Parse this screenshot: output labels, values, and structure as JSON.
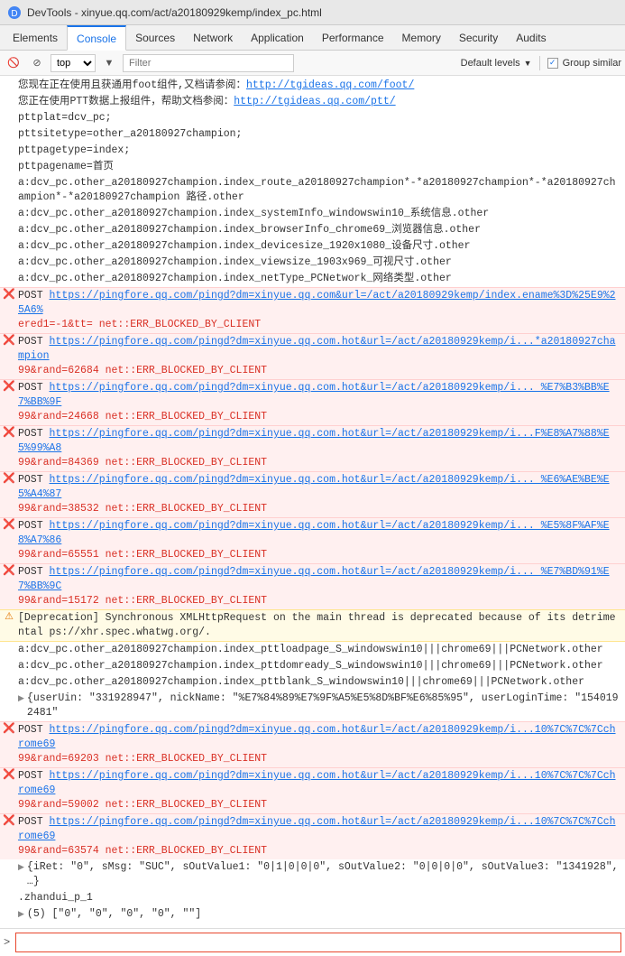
{
  "titleBar": {
    "icon": "devtools-icon",
    "title": "DevTools - xinyue.qq.com/act/a20180929kemp/index_pc.html"
  },
  "navTabs": [
    {
      "id": "elements",
      "label": "Elements",
      "active": false
    },
    {
      "id": "console",
      "label": "Console",
      "active": true
    },
    {
      "id": "sources",
      "label": "Sources",
      "active": false
    },
    {
      "id": "network",
      "label": "Network",
      "active": false
    },
    {
      "id": "application",
      "label": "Application",
      "active": false
    },
    {
      "id": "performance",
      "label": "Performance",
      "active": false
    },
    {
      "id": "memory",
      "label": "Memory",
      "active": false
    },
    {
      "id": "security",
      "label": "Security",
      "active": false
    },
    {
      "id": "audits",
      "label": "Audits",
      "active": false
    }
  ],
  "toolbar": {
    "topLabel": "top",
    "filterPlaceholder": "Filter",
    "defaultLevelsLabel": "Default levels",
    "groupSimilarLabel": "Group similar",
    "groupSimilarChecked": true
  },
  "consoleLines": [
    {
      "type": "info",
      "text": "您现在正在使用且获通用foot组件,又档请参阅:",
      "link": "http://tgideas.qq.com/foot/",
      "linkText": "http://tgideas.qq.com/foot/"
    },
    {
      "type": "info",
      "text": "您正在使用PTT数据上报组件，帮助文档参阅：",
      "link": "http://tgideas.qq.com/ptt/",
      "linkText": "http://tgideas.qq.com/ptt/"
    },
    {
      "type": "info",
      "text": "pttplat=dcv_pc;"
    },
    {
      "type": "info",
      "text": "pttsitetype=other_a20180927champion;"
    },
    {
      "type": "info",
      "text": "pttpagetype=index;"
    },
    {
      "type": "info",
      "text": "pttpagename=首页"
    },
    {
      "type": "info",
      "text": "a:dcv_pc.other_a20180927champion.index_route_a20180927champion*-*a20180927champion*-*a20180927champion*-*a20180927champion 路径.other"
    },
    {
      "type": "info",
      "text": "a:dcv_pc.other_a20180927champion.index_systemInfo_windowswin10_系统信息.other"
    },
    {
      "type": "info",
      "text": "a:dcv_pc.other_a20180927champion.index_browserInfo_chrome69_浏览器信息.other"
    },
    {
      "type": "info",
      "text": "a:dcv_pc.other_a20180927champion.index_devicesize_1920x1080_设备尺寸.other"
    },
    {
      "type": "info",
      "text": "a:dcv_pc.other_a20180927champion.index_viewsize_1903x969_可视尺寸.other"
    },
    {
      "type": "info",
      "text": "a:dcv_pc.other_a20180927champion.index_netType_PCNetwork_网络类型.other"
    },
    {
      "type": "error",
      "prefix": "❌ POST ",
      "url": "https://pingfore.qq.com/pingd?dm=xinyue.qq.com&url=/act/a20180929kemp/index.ename%3D%25E9%25A6%",
      "suffix": "ered1=-1&tt= net::ERR_BLOCKED_BY_CLIENT"
    },
    {
      "type": "error",
      "prefix": "❌ POST ",
      "url": "https://pingfore.qq.com/pingd?dm=xinyue.qq.com.hot&url=/act/a20180929kemp/i...*a20180927champion",
      "suffix": "99&rand=62684 net::ERR_BLOCKED_BY_CLIENT"
    },
    {
      "type": "error",
      "prefix": "❌ POST ",
      "url": "https://pingfore.qq.com/pingd?dm=xinyue.qq.com.hot&url=/act/a20180929kemp/i... %E7%B3%BB%E7%BB%9F",
      "suffix": "99&rand=24668 net::ERR_BLOCKED_BY_CLIENT"
    },
    {
      "type": "error",
      "prefix": "❌ POST ",
      "url": "https://pingfore.qq.com/pingd?dm=xinyue.qq.com.hot&url=/act/a20180929kemp/i...F%E8%A7%88%E5%99%A8",
      "suffix": "99&rand=84369 net::ERR_BLOCKED_BY_CLIENT"
    },
    {
      "type": "error",
      "prefix": "❌ POST ",
      "url": "https://pingfore.qq.com/pingd?dm=xinyue.qq.com.hot&url=/act/a20180929kemp/i... %E6%AE%BE%E5%A4%87",
      "suffix": "99&rand=38532 net::ERR_BLOCKED_BY_CLIENT"
    },
    {
      "type": "error",
      "prefix": "❌ POST ",
      "url": "https://pingfore.qq.com/pingd?dm=xinyue.qq.com.hot&url=/act/a20180929kemp/i... %E5%8F%AF%E8%A7%86",
      "suffix": "99&rand=65551 net::ERR_BLOCKED_BY_CLIENT"
    },
    {
      "type": "error",
      "prefix": "❌ POST ",
      "url": "https://pingfore.qq.com/pingd?dm=xinyue.qq.com.hot&url=/act/a20180929kemp/i... %E7%BD%91%E7%BB%9C",
      "suffix": "99&rand=15172 net::ERR_BLOCKED_BY_CLIENT"
    },
    {
      "type": "warning",
      "text": "⚠ [Deprecation] Synchronous XMLHttpRequest on the main thread is deprecated because of its detrimental ps://xhr.spec.whatwg.org/."
    },
    {
      "type": "info",
      "text": "a:dcv_pc.other_a20180927champion.index_pttloadpage_S_windowswin10|||chrome69|||PCNetwork.other"
    },
    {
      "type": "info",
      "text": "a:dcv_pc.other_a20180927champion.index_pttdomready_S_windowswin10|||chrome69|||PCNetwork.other"
    },
    {
      "type": "info",
      "text": "a:dcv_pc.other_a20180927champion.index_pttblank_S_windowswin10|||chrome69|||PCNetwork.other"
    },
    {
      "type": "expandable",
      "arrow": "▶",
      "text": "{userUin: \"331928947\", nickName: \"%E7%84%89%E7%9F%A5%E5%8D%BF%E6%85%95\", userLoginTime: \"1540192481\""
    },
    {
      "type": "error",
      "prefix": "❌ POST ",
      "url": "https://pingfore.qq.com/pingd?dm=xinyue.qq.com.hot&url=/act/a20180929kemp/i...10%7C%7C%7Cchrome69",
      "suffix": "99&rand=69203 net::ERR_BLOCKED_BY_CLIENT"
    },
    {
      "type": "error",
      "prefix": "❌ POST ",
      "url": "https://pingfore.qq.com/pingd?dm=xinyue.qq.com.hot&url=/act/a20180929kemp/i...10%7C%7C%7Cchrome69",
      "suffix": "99&rand=59002 net::ERR_BLOCKED_BY_CLIENT"
    },
    {
      "type": "error",
      "prefix": "❌ POST ",
      "url": "https://pingfore.qq.com/pingd?dm=xinyue.qq.com.hot&url=/act/a20180929kemp/i...10%7C%7C%7Cchrome69",
      "suffix": "99&rand=63574 net::ERR_BLOCKED_BY_CLIENT"
    },
    {
      "type": "expandable",
      "arrow": "▶",
      "text": "{iRet: \"0\", sMsg: \"SUC\", sOutValue1: \"0|1|0|0|0\", sOutValue2: \"0|0|0|0\", sOutValue3: \"1341928\", …}"
    },
    {
      "type": "info",
      "text": ".zhandui_p_1"
    },
    {
      "type": "expandable",
      "arrow": "▶",
      "text": "(5) [\"0\", \"0\", \"0\", \"0\", \"\"]"
    }
  ],
  "consoleInput": {
    "prompt": ">",
    "placeholder": ""
  }
}
